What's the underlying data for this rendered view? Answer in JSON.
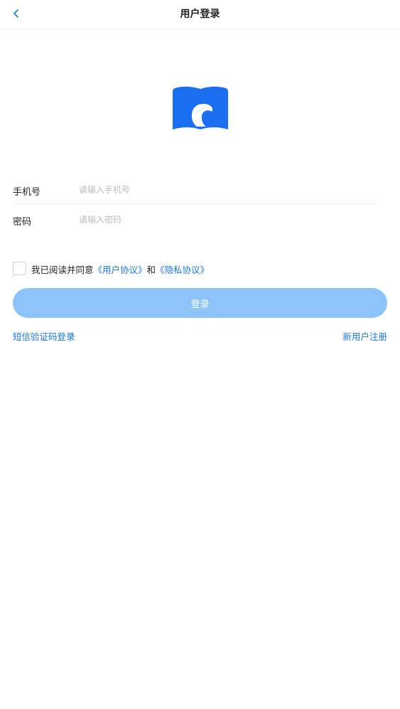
{
  "header": {
    "title": "用户登录",
    "back_icon": "chevron-left-icon"
  },
  "logo": {
    "icon": "book-c-logo",
    "color": "#1a6ff0"
  },
  "form": {
    "phone": {
      "label": "手机号",
      "placeholder": "请输入手机号",
      "value": ""
    },
    "password": {
      "label": "密码",
      "placeholder": "请输入密码",
      "value": ""
    }
  },
  "agreement": {
    "checked": false,
    "prefix": "我已阅读并同意",
    "user_agreement": "《用户协议》",
    "and": "和",
    "privacy_agreement": "《隐私协议》"
  },
  "login_button": {
    "label": "登录"
  },
  "links": {
    "sms_login": "短信验证码登录",
    "register": "新用户注册"
  },
  "colors": {
    "accent": "#1677e6",
    "button_disabled": "#8ec3fa",
    "placeholder": "#bdbdbd"
  }
}
